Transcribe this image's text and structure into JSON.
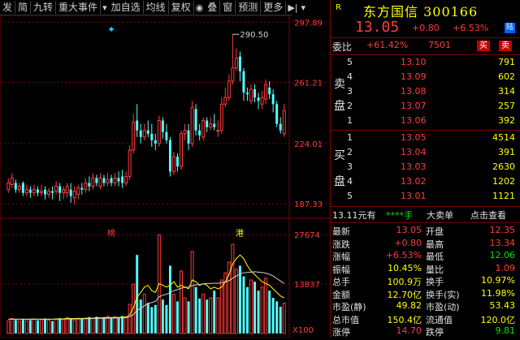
{
  "toolbar": {
    "items": [
      "发",
      "简",
      "九转",
      "重大事件",
      "加自选",
      "均线",
      "复权",
      "叠",
      "窗",
      "预测",
      "更多"
    ],
    "icons": [
      "dropdown-icon",
      "eye-icon",
      "gear-icon",
      "play-icon",
      "menu-icon"
    ]
  },
  "chart": {
    "y_labels": [
      "297.89",
      "261.21",
      "224.01",
      "187.33"
    ],
    "vol_labels": [
      "27674",
      "13837",
      "X100"
    ],
    "peak_label": "290.50",
    "markers": {
      "bang": "榜",
      "gang": "港"
    },
    "colors": {
      "up": "#ff3c3c",
      "down": "#54ffff",
      "ma": "#ffff00",
      "ma2": "#d0d0d0"
    }
  },
  "chart_data": {
    "type": "candlestick",
    "ylim": [
      180,
      300
    ],
    "volume_ylim": [
      0,
      30000
    ],
    "candles": [
      {
        "o": 196.0,
        "c": 200.0,
        "h": 203.0,
        "l": 194.0
      },
      {
        "o": 199.0,
        "c": 203.0,
        "h": 206.0,
        "l": 197.0
      },
      {
        "o": 200.0,
        "c": 196.0,
        "h": 202.0,
        "l": 194.0
      },
      {
        "o": 196.0,
        "c": 198.0,
        "h": 200.0,
        "l": 194.0
      },
      {
        "o": 200.0,
        "c": 194.0,
        "h": 201.0,
        "l": 192.0
      },
      {
        "o": 194.0,
        "c": 196.0,
        "h": 199.0,
        "l": 192.0
      },
      {
        "o": 196.0,
        "c": 194.0,
        "h": 198.0,
        "l": 191.0
      },
      {
        "o": 194.0,
        "c": 196.0,
        "h": 199.0,
        "l": 192.0
      },
      {
        "o": 196.0,
        "c": 194.0,
        "h": 198.0,
        "l": 192.0
      },
      {
        "o": 194.0,
        "c": 195.0,
        "h": 199.0,
        "l": 192.0
      },
      {
        "o": 196.0,
        "c": 193.0,
        "h": 198.0,
        "l": 190.0
      },
      {
        "o": 193.0,
        "c": 195.0,
        "h": 197.0,
        "l": 191.0
      },
      {
        "o": 195.0,
        "c": 194.0,
        "h": 198.0,
        "l": 190.0
      },
      {
        "o": 195.0,
        "c": 198.0,
        "h": 201.0,
        "l": 193.0
      },
      {
        "o": 198.0,
        "c": 194.0,
        "h": 200.0,
        "l": 189.0
      },
      {
        "o": 194.0,
        "c": 196.0,
        "h": 198.0,
        "l": 190.0
      },
      {
        "o": 194.0,
        "c": 198.0,
        "h": 200.0,
        "l": 191.0
      },
      {
        "o": 196.0,
        "c": 192.0,
        "h": 200.0,
        "l": 188.0
      },
      {
        "o": 191.0,
        "c": 195.0,
        "h": 198.0,
        "l": 187.0
      },
      {
        "o": 193.0,
        "c": 197.0,
        "h": 199.0,
        "l": 190.0
      },
      {
        "o": 197.0,
        "c": 196.0,
        "h": 200.0,
        "l": 193.0
      },
      {
        "o": 196.0,
        "c": 200.0,
        "h": 203.0,
        "l": 194.0
      },
      {
        "o": 200.0,
        "c": 198.0,
        "h": 204.0,
        "l": 195.0
      },
      {
        "o": 198.0,
        "c": 203.0,
        "h": 206.0,
        "l": 196.0
      },
      {
        "o": 203.0,
        "c": 200.0,
        "h": 205.0,
        "l": 198.0
      },
      {
        "o": 198.0,
        "c": 203.0,
        "h": 206.0,
        "l": 196.0
      },
      {
        "o": 203.0,
        "c": 200.0,
        "h": 205.0,
        "l": 198.0
      },
      {
        "o": 200.0,
        "c": 202.0,
        "h": 206.0,
        "l": 198.0
      },
      {
        "o": 203.0,
        "c": 200.0,
        "h": 205.0,
        "l": 198.0
      },
      {
        "o": 200.0,
        "c": 203.0,
        "h": 206.0,
        "l": 198.0
      },
      {
        "o": 203.0,
        "c": 201.0,
        "h": 207.0,
        "l": 198.0
      },
      {
        "o": 204.0,
        "c": 200.0,
        "h": 208.0,
        "l": 197.0
      },
      {
        "o": 200.0,
        "c": 204.0,
        "h": 207.0,
        "l": 198.0
      },
      {
        "o": 204.0,
        "c": 220.0,
        "h": 223.0,
        "l": 202.0
      },
      {
        "o": 220.0,
        "c": 237.0,
        "h": 242.0,
        "l": 218.0
      },
      {
        "o": 238.0,
        "c": 232.0,
        "h": 248.0,
        "l": 228.0
      },
      {
        "o": 232.0,
        "c": 228.0,
        "h": 236.0,
        "l": 224.0
      },
      {
        "o": 228.0,
        "c": 232.0,
        "h": 236.0,
        "l": 226.0
      },
      {
        "o": 232.0,
        "c": 230.0,
        "h": 238.0,
        "l": 228.0
      },
      {
        "o": 230.0,
        "c": 226.0,
        "h": 236.0,
        "l": 222.0
      },
      {
        "o": 226.0,
        "c": 224.0,
        "h": 230.0,
        "l": 220.0
      },
      {
        "o": 224.0,
        "c": 238.0,
        "h": 241.0,
        "l": 222.0
      },
      {
        "o": 238.0,
        "c": 231.0,
        "h": 240.0,
        "l": 227.0
      },
      {
        "o": 231.0,
        "c": 226.0,
        "h": 236.0,
        "l": 224.0
      },
      {
        "o": 226.0,
        "c": 207.0,
        "h": 228.0,
        "l": 204.0
      },
      {
        "o": 207.0,
        "c": 216.0,
        "h": 219.0,
        "l": 205.0
      },
      {
        "o": 216.0,
        "c": 210.0,
        "h": 218.0,
        "l": 207.0
      },
      {
        "o": 210.0,
        "c": 230.0,
        "h": 232.0,
        "l": 208.0
      },
      {
        "o": 230.0,
        "c": 232.0,
        "h": 236.0,
        "l": 226.0
      },
      {
        "o": 232.0,
        "c": 224.0,
        "h": 236.0,
        "l": 220.0
      },
      {
        "o": 224.0,
        "c": 246.0,
        "h": 250.0,
        "l": 222.0
      },
      {
        "o": 245.0,
        "c": 232.0,
        "h": 248.0,
        "l": 229.0
      },
      {
        "o": 232.0,
        "c": 229.0,
        "h": 236.0,
        "l": 226.0
      },
      {
        "o": 228.0,
        "c": 238.0,
        "h": 240.0,
        "l": 226.0
      },
      {
        "o": 238.0,
        "c": 234.0,
        "h": 240.0,
        "l": 231.0
      },
      {
        "o": 234.0,
        "c": 236.0,
        "h": 240.0,
        "l": 232.0
      },
      {
        "o": 236.0,
        "c": 234.0,
        "h": 242.0,
        "l": 232.0
      },
      {
        "o": 232.0,
        "c": 232.0,
        "h": 238.0,
        "l": 228.0
      },
      {
        "o": 232.0,
        "c": 248.0,
        "h": 252.0,
        "l": 230.0
      },
      {
        "o": 248.0,
        "c": 252.0,
        "h": 258.0,
        "l": 246.0
      },
      {
        "o": 252.0,
        "c": 262.0,
        "h": 266.0,
        "l": 250.0
      },
      {
        "o": 262.0,
        "c": 270.0,
        "h": 290.5,
        "l": 260.0
      },
      {
        "o": 270.0,
        "c": 276.0,
        "h": 282.0,
        "l": 268.0
      },
      {
        "o": 277.0,
        "c": 268.0,
        "h": 280.0,
        "l": 262.0
      },
      {
        "o": 268.0,
        "c": 255.0,
        "h": 270.0,
        "l": 250.0
      },
      {
        "o": 255.0,
        "c": 254.0,
        "h": 258.0,
        "l": 250.0
      },
      {
        "o": 250.0,
        "c": 257.0,
        "h": 260.0,
        "l": 248.0
      },
      {
        "o": 257.0,
        "c": 252.0,
        "h": 260.0,
        "l": 249.0
      },
      {
        "o": 252.0,
        "c": 250.0,
        "h": 255.0,
        "l": 245.0
      },
      {
        "o": 248.0,
        "c": 252.0,
        "h": 256.0,
        "l": 245.0
      },
      {
        "o": 251.0,
        "c": 260.0,
        "h": 263.0,
        "l": 248.0
      },
      {
        "o": 258.0,
        "c": 254.0,
        "h": 262.0,
        "l": 251.0
      },
      {
        "o": 254.0,
        "c": 248.0,
        "h": 257.0,
        "l": 243.0
      },
      {
        "o": 248.0,
        "c": 236.0,
        "h": 250.0,
        "l": 234.0
      },
      {
        "o": 236.0,
        "c": 232.0,
        "h": 240.0,
        "l": 230.0
      },
      {
        "o": 230.0,
        "c": 244.0,
        "h": 248.0,
        "l": 228.0
      }
    ],
    "volume": [
      3500,
      4200,
      3800,
      3500,
      4000,
      3600,
      3800,
      4100,
      3700,
      3900,
      4200,
      3700,
      3500,
      4000,
      4300,
      4000,
      4500,
      4100,
      3800,
      4300,
      4000,
      4200,
      4600,
      4300,
      4700,
      4300,
      4600,
      4800,
      4200,
      4700,
      4400,
      4900,
      4500,
      8200,
      13837,
      22000,
      9500,
      11000,
      8600,
      7400,
      8000,
      27674,
      9500,
      8000,
      19000,
      11000,
      9000,
      17500,
      10000,
      9000,
      23000,
      13000,
      9800,
      11000,
      9500,
      10000,
      12000,
      10000,
      15000,
      17000,
      20000,
      25000,
      18000,
      19000,
      16000,
      13000,
      15000,
      14500,
      12000,
      13000,
      15500,
      12000,
      10000,
      9000,
      7500,
      8500
    ],
    "ma_volume": [
      4000,
      4000,
      4000,
      4000,
      4000,
      4000,
      4000,
      4000,
      4000,
      4000,
      4000,
      4000,
      4000,
      4100,
      4100,
      4100,
      4200,
      4200,
      4200,
      4200,
      4200,
      4300,
      4300,
      4300,
      4400,
      4400,
      4400,
      4500,
      4500,
      4500,
      4500,
      4600,
      4600,
      5200,
      7200,
      10200,
      11500,
      13000,
      13500,
      12000,
      11500,
      14000,
      13500,
      13000,
      13500,
      14500,
      13000,
      13500,
      13000,
      12500,
      15000,
      14500,
      13500,
      14000,
      13500,
      12500,
      13000,
      12500,
      13000,
      14500,
      16500,
      19500,
      21000,
      22000,
      21000,
      19000,
      17500,
      16500,
      15500,
      14500,
      14000,
      13500,
      12500,
      11500,
      10500,
      10000
    ],
    "ma_volume2": [
      4000,
      4000,
      4000,
      4000,
      4000,
      4000,
      4000,
      4000,
      4000,
      4000,
      4000,
      4000,
      4000,
      4000,
      4000,
      4000,
      4050,
      4050,
      4100,
      4100,
      4100,
      4150,
      4150,
      4200,
      4200,
      4250,
      4250,
      4300,
      4300,
      4350,
      4350,
      4400,
      4400,
      4700,
      5300,
      6500,
      7000,
      7800,
      8400,
      8700,
      9000,
      10300,
      10700,
      11000,
      11500,
      12000,
      12300,
      12700,
      12900,
      13000,
      13400,
      13600,
      13700,
      13900,
      14000,
      14000,
      14100,
      14100,
      14200,
      14400,
      14800,
      15500,
      16100,
      16700,
      17000,
      17100,
      17200,
      17300,
      17200,
      17100,
      16900,
      16600,
      16100,
      15400,
      14700,
      14000
    ]
  },
  "panel": {
    "r_badge": "R",
    "stock_name": "东方国信 300166",
    "price": "13.05",
    "change": "+0.80",
    "pct": "+6.53%",
    "lu": "陆",
    "weibi_label": "委比",
    "weibi_pct": "+61.42%",
    "weibi_val": "7501",
    "buy_btn": "买",
    "sell_btn": "卖",
    "sell_label": [
      "卖",
      "盘"
    ],
    "buy_label": [
      "买",
      "盘"
    ],
    "sells": [
      {
        "lvl": "5",
        "price": "13.10",
        "vol": "791"
      },
      {
        "lvl": "4",
        "price": "13.09",
        "vol": "602"
      },
      {
        "lvl": "3",
        "price": "13.08",
        "vol": "314"
      },
      {
        "lvl": "2",
        "price": "13.07",
        "vol": "257"
      },
      {
        "lvl": "1",
        "price": "13.06",
        "vol": "392"
      }
    ],
    "buys": [
      {
        "lvl": "1",
        "price": "13.05",
        "vol": "4514"
      },
      {
        "lvl": "2",
        "price": "13.04",
        "vol": "391"
      },
      {
        "lvl": "3",
        "price": "13.03",
        "vol": "2630"
      },
      {
        "lvl": "4",
        "price": "13.02",
        "vol": "1202"
      },
      {
        "lvl": "5",
        "price": "13.01",
        "vol": "1121"
      }
    ],
    "ad": {
      "price": "13.11元有",
      "stars": "****手",
      "big": "大卖单",
      "link": "点击查看"
    },
    "stats": [
      {
        "l1": "最新",
        "v1": "13.05",
        "c1": "red",
        "l2": "开盘",
        "v2": "12.35",
        "c2": "red"
      },
      {
        "l1": "涨跌",
        "v1": "+0.80",
        "c1": "red",
        "l2": "最高",
        "v2": "13.34",
        "c2": "red"
      },
      {
        "l1": "涨幅",
        "v1": "+6.53%",
        "c1": "red",
        "l2": "最低",
        "v2": "12.06",
        "c2": "green"
      },
      {
        "l1": "振幅",
        "v1": "10.45%",
        "c1": "yellow",
        "l2": "量比",
        "v2": "1.09",
        "c2": "red"
      },
      {
        "l1": "总手",
        "v1": "100.9万",
        "c1": "yellow",
        "l2": "换手",
        "v2": "10.97%",
        "c2": "yellow"
      },
      {
        "l1": "金额",
        "v1": "12.70亿",
        "c1": "yellow",
        "l2": "换手(实)",
        "v2": "11.98%",
        "c2": "yellow"
      },
      {
        "l1": "市盈(静)",
        "v1": "49.82",
        "c1": "yellow",
        "l2": "市盈(动)",
        "v2": "53.43",
        "c2": "yellow"
      },
      {
        "l1": "总市值",
        "v1": "150.4亿",
        "c1": "yellow",
        "l2": "流通值",
        "v2": "120.0亿",
        "c2": "yellow"
      },
      {
        "l1": "涨停",
        "v1": "14.70",
        "c1": "red",
        "l2": "跌停",
        "v2": "9.81",
        "c2": "green"
      }
    ]
  }
}
